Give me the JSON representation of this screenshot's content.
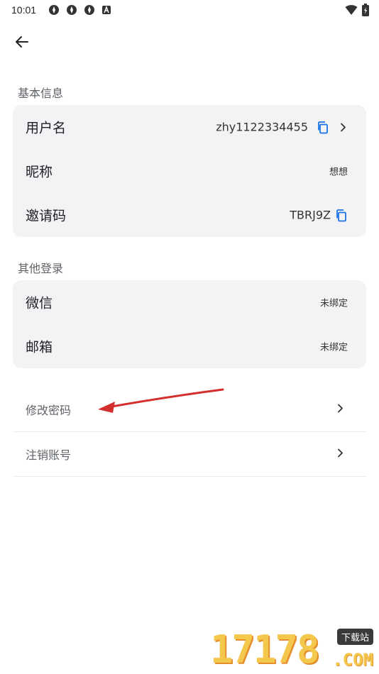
{
  "status_bar": {
    "time": "10:01"
  },
  "sections": {
    "basic": {
      "title": "基本信息",
      "username_label": "用户名",
      "username_value": "zhy1122334455",
      "nickname_label": "昵称",
      "nickname_value": "想想",
      "invite_label": "邀请码",
      "invite_value": "TBRJ9Z"
    },
    "other_login": {
      "title": "其他登录",
      "wechat_label": "微信",
      "wechat_value": "未绑定",
      "email_label": "邮箱",
      "email_value": "未绑定"
    },
    "actions": {
      "change_password": "修改密码",
      "delete_account": "注销账号"
    }
  },
  "watermark": {
    "digits": "17178",
    "tag": "下载站",
    "suffix": ".COM"
  },
  "colors": {
    "accent": "#1a73e8",
    "card_bg": "#f3f3f5",
    "annotation_arrow": "#d32f2f"
  },
  "icons": {
    "back": "arrow-left-icon",
    "copy": "copy-icon",
    "chevron": "chevron-right-icon"
  }
}
